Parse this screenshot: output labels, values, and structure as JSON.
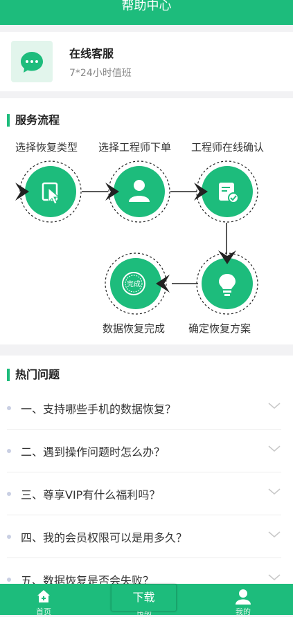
{
  "header": {
    "title": "帮助中心"
  },
  "customer_service": {
    "title": "在线客服",
    "subtitle": "7*24小时值班"
  },
  "flow": {
    "title": "服务流程",
    "steps": [
      "选择恢复类型",
      "选择工程师下单",
      "工程师在线确认",
      "确定恢复方案",
      "数据恢复完成"
    ],
    "stamp_text": "完成"
  },
  "faq": {
    "title": "热门问题",
    "items": [
      "一、支持哪些手机的数据恢复？",
      "二、遇到操作问题时怎么办？",
      "三、尊享VIP有什么福利吗？",
      "四、我的会员权限可以是用多久？",
      "五、数据恢复是否会失败？"
    ]
  },
  "tabbar": {
    "home": "首页",
    "help": "帮助",
    "mine": "我的",
    "download": "下载"
  },
  "colors": {
    "brand": "#1dbc7c",
    "icon_bg": "#e2f5ec"
  }
}
